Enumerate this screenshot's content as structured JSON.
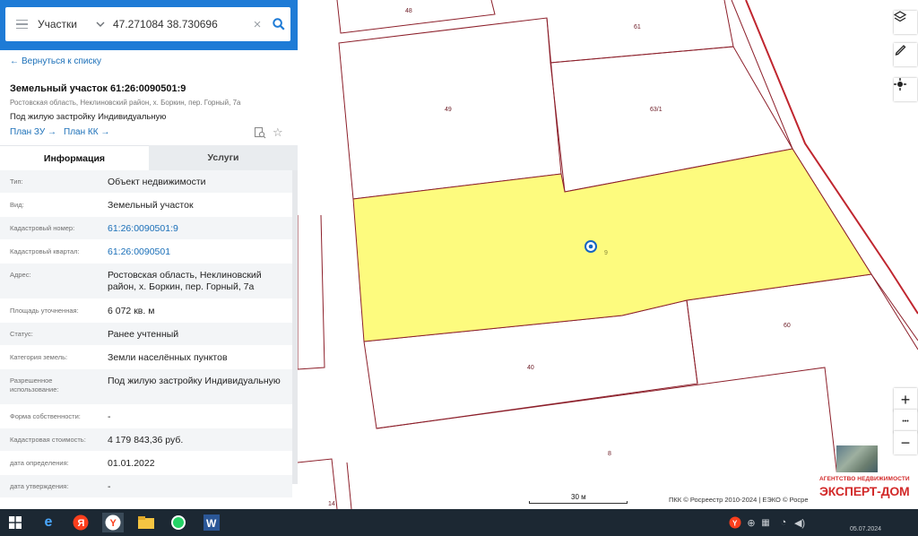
{
  "search": {
    "category": "Участки",
    "value": "47.271084 38.730696",
    "clear_glyph": "×"
  },
  "panel": {
    "back_link": "Вернуться к списку",
    "title": "Земельный участок 61:26:0090501:9",
    "address_line": "Ростовская область, Неклиновский район, х. Боркин, пер. Горный, 7а",
    "use_line": "Под жилую застройку Индивидуальную",
    "plan_zu": "План ЗУ",
    "plan_kk": "План КК",
    "arrow": "→"
  },
  "tabs": [
    {
      "label": "Информация",
      "active": true
    },
    {
      "label": "Услуги",
      "active": false
    }
  ],
  "info_rows": [
    {
      "key": "Тип:",
      "value": "Объект недвижимости"
    },
    {
      "key": "Вид:",
      "value": "Земельный участок"
    },
    {
      "key": "Кадастровый номер:",
      "value": "61:26:0090501:9",
      "link": true
    },
    {
      "key": "Кадастровый квартал:",
      "value": "61:26:0090501",
      "link": true
    },
    {
      "key": "Адрес:",
      "value": "Ростовская область, Неклиновский район, х. Боркин, пер. Горный, 7а"
    },
    {
      "key": "Площадь уточненная:",
      "value": "6 072 кв. м"
    },
    {
      "key": "Статус:",
      "value": "Ранее учтенный"
    },
    {
      "key": "Категория земель:",
      "value": "Земли населённых пунктов"
    },
    {
      "key": "Разрешенное использование:",
      "value": "Под жилую застройку Индивидуальную"
    },
    {
      "key": "Форма собственности:",
      "value": "-"
    },
    {
      "key": "Кадастровая стоимость:",
      "value": "4 179 843,36 руб."
    },
    {
      "key": "дата определения:",
      "value": "01.01.2022"
    },
    {
      "key": "дата утверждения:",
      "value": "-"
    }
  ],
  "map": {
    "parcel_labels": [
      "48",
      "61",
      "49",
      "63/1",
      "9",
      "60",
      "40",
      "8",
      "14"
    ],
    "scale_label": "30 м",
    "copyright": "ПКК © Росреестр 2010-2024 | ЕЭКО © Росре",
    "zoom_in": "+",
    "more": "•••",
    "zoom_out": "−",
    "colors": {
      "selected_fill": "#fdfb7e",
      "parcel_border": "#8c1f2a",
      "road_line": "#c0262f"
    }
  },
  "watermark": {
    "top": "АГЕНТСТВО НЕДВИЖИМОСТИ",
    "main": "ЭКСПЕРТ-ДОМ"
  },
  "taskbar": {
    "date": "05.07.2024",
    "icons": [
      "windows-start",
      "edge",
      "yandex",
      "yandex-browser",
      "file-explorer",
      "whatsapp",
      "word"
    ]
  }
}
